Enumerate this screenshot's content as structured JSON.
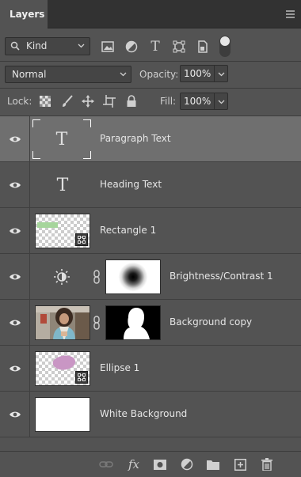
{
  "panel": {
    "tab_label": "Layers"
  },
  "filter": {
    "kind_label": "Kind"
  },
  "blend": {
    "mode": "Normal",
    "opacity_label": "Opacity:",
    "opacity_value": "100%"
  },
  "lock": {
    "label": "Lock:",
    "fill_label": "Fill:",
    "fill_value": "100%"
  },
  "layers": [
    {
      "name": "Paragraph Text",
      "kind": "type",
      "selected": true,
      "visible": true
    },
    {
      "name": "Heading Text",
      "kind": "type",
      "selected": false,
      "visible": true
    },
    {
      "name": "Rectangle 1",
      "kind": "shape",
      "selected": false,
      "visible": true
    },
    {
      "name": "Brightness/Contrast 1",
      "kind": "adjustment",
      "selected": false,
      "visible": true
    },
    {
      "name": "Background copy",
      "kind": "pixel-with-mask",
      "selected": false,
      "visible": true
    },
    {
      "name": "Ellipse 1",
      "kind": "shape",
      "selected": false,
      "visible": true
    },
    {
      "name": "White Background",
      "kind": "pixel",
      "selected": false,
      "visible": true
    }
  ],
  "colors": {
    "panel_bg": "#535353",
    "selected_row": "#6f6f6f",
    "rectangle_fill": "#a6d59c",
    "ellipse_fill": "#c996c4"
  },
  "footer": {
    "fx_label": "fx"
  }
}
